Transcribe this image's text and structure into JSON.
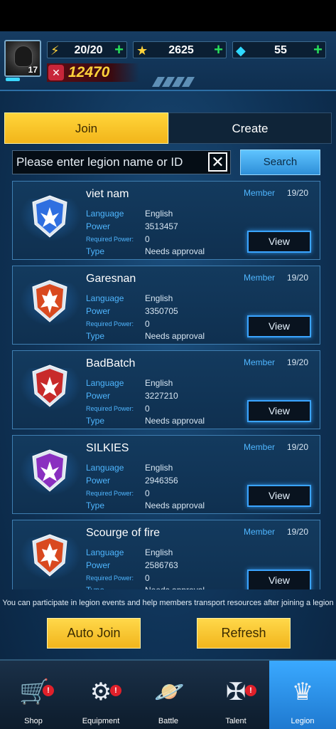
{
  "header": {
    "level": "17",
    "energy": {
      "value": "20/20",
      "plus": "+"
    },
    "stars": {
      "value": "2625",
      "plus": "+"
    },
    "gems": {
      "value": "55",
      "plus": "+"
    },
    "power": "12470"
  },
  "tabs": {
    "join": "Join",
    "create": "Create"
  },
  "search": {
    "placeholder": "Please enter legion name or ID",
    "clear": "✕",
    "button": "Search"
  },
  "labels": {
    "language": "Language",
    "power": "Power",
    "required_power": "Required Power:",
    "type": "Type",
    "member": "Member",
    "view": "View"
  },
  "legions": [
    {
      "name": "viet nam",
      "members": "19/20",
      "language": "English",
      "power": "3513457",
      "required_power": "0",
      "type": "Needs approval",
      "color": "#2f6fe0"
    },
    {
      "name": "Garesnan",
      "members": "19/20",
      "language": "English",
      "power": "3350705",
      "required_power": "0",
      "type": "Needs approval",
      "color": "#d9491f"
    },
    {
      "name": "BadBatch",
      "members": "19/20",
      "language": "English",
      "power": "3227210",
      "required_power": "0",
      "type": "Needs approval",
      "color": "#c82a2a"
    },
    {
      "name": "SILKIES",
      "members": "19/20",
      "language": "English",
      "power": "2946356",
      "required_power": "0",
      "type": "Needs approval",
      "color": "#8a2fc0"
    },
    {
      "name": "Scourge of fire",
      "members": "19/20",
      "language": "English",
      "power": "2586763",
      "required_power": "0",
      "type": "Needs approval",
      "color": "#d9491f"
    }
  ],
  "info_text": "You can participate in legion events and help members transport resources after joining a legion",
  "actions": {
    "auto_join": "Auto Join",
    "refresh": "Refresh"
  },
  "nav": [
    {
      "label": "Shop",
      "icon": "shop-cart-icon",
      "badge": "!"
    },
    {
      "label": "Equipment",
      "icon": "equipment-icon",
      "badge": "!"
    },
    {
      "label": "Battle",
      "icon": "planet-icon",
      "badge": ""
    },
    {
      "label": "Talent",
      "icon": "talent-icon",
      "badge": "!"
    },
    {
      "label": "Legion",
      "icon": "legion-crest-icon",
      "badge": ""
    }
  ],
  "colors": {
    "accent_yellow": "#f2b51a",
    "accent_blue": "#3aa4ff",
    "plus_green": "#28e05a",
    "power_gold": "#ffd23a"
  }
}
